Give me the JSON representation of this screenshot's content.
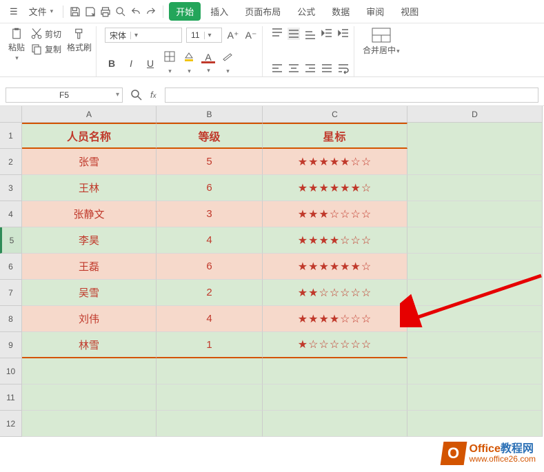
{
  "menu": {
    "file": "文件",
    "tabs": [
      "开始",
      "插入",
      "页面布局",
      "公式",
      "数据",
      "审阅",
      "视图"
    ]
  },
  "ribbon": {
    "paste": "粘贴",
    "cut": "剪切",
    "copy": "复制",
    "format_painter": "格式刷",
    "font": "宋体",
    "size": "11",
    "merge": "合并居中"
  },
  "namebox": "F5",
  "columns": [
    "A",
    "B",
    "C",
    "D"
  ],
  "header": {
    "name": "人员名称",
    "level": "等级",
    "stars": "星标"
  },
  "data": [
    {
      "name": "张雪",
      "level": "5",
      "stars": "★★★★★☆☆"
    },
    {
      "name": "王林",
      "level": "6",
      "stars": "★★★★★★☆"
    },
    {
      "name": "张静文",
      "level": "3",
      "stars": "★★★☆☆☆☆"
    },
    {
      "name": "李昊",
      "level": "4",
      "stars": "★★★★☆☆☆"
    },
    {
      "name": "王磊",
      "level": "6",
      "stars": "★★★★★★☆"
    },
    {
      "name": "吴雪",
      "level": "2",
      "stars": "★★☆☆☆☆☆"
    },
    {
      "name": "刘伟",
      "level": "4",
      "stars": "★★★★☆☆☆"
    },
    {
      "name": "林雪",
      "level": "1",
      "stars": "★☆☆☆☆☆☆"
    }
  ],
  "row_labels": [
    "1",
    "2",
    "3",
    "4",
    "5",
    "6",
    "7",
    "8",
    "9",
    "10",
    "11",
    "12"
  ],
  "watermark": {
    "title_a": "Office",
    "title_b": "教程网",
    "url": "www.office26.com"
  }
}
